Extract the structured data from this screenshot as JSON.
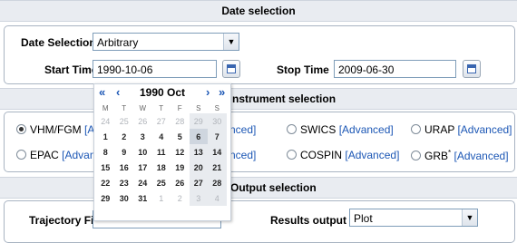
{
  "date_section": {
    "title": "Date selection",
    "date_selection_label": "Date Selection",
    "date_selection_value": "Arbitrary",
    "start_time_label": "Start Time",
    "start_time_value": "1990-10-06",
    "stop_time_label": "Stop Time",
    "stop_time_value": "2009-06-30"
  },
  "instrument_section": {
    "title_visible": "nstrument selection",
    "items": [
      {
        "name": "VHM/FGM",
        "adv": "[Adv",
        "checked": true
      },
      {
        "name": "",
        "adv": "nced]",
        "checked": false
      },
      {
        "name": "SWICS",
        "adv": "[Advanced]",
        "checked": false
      },
      {
        "name": "URAP",
        "adv": "[Advanced]",
        "checked": false
      },
      {
        "name": "EPAC",
        "adv": "[Advance",
        "checked": false
      },
      {
        "name": "",
        "adv": "nced]",
        "checked": false
      },
      {
        "name": "COSPIN",
        "adv": "[Advanced]",
        "checked": false
      },
      {
        "name": "GRB",
        "sup": "*",
        "adv": "[Advanced]",
        "checked": false
      }
    ]
  },
  "output_section": {
    "title_visible": "Output selection",
    "trajectory_label": "Trajectory File",
    "results_label": "Results output",
    "results_value": "Plot"
  },
  "calendar": {
    "nav_prev_year": "«",
    "nav_prev_month": "‹",
    "nav_next_month": "›",
    "nav_next_year": "»",
    "title": "1990 Oct",
    "weekdays": [
      "M",
      "T",
      "W",
      "T",
      "F",
      "S",
      "S"
    ],
    "weeks": [
      [
        "24",
        "25",
        "26",
        "27",
        "28",
        "29",
        "30"
      ],
      [
        "1",
        "2",
        "3",
        "4",
        "5",
        "6",
        "7"
      ],
      [
        "8",
        "9",
        "10",
        "11",
        "12",
        "13",
        "14"
      ],
      [
        "15",
        "16",
        "17",
        "18",
        "19",
        "20",
        "21"
      ],
      [
        "22",
        "23",
        "24",
        "25",
        "26",
        "27",
        "28"
      ],
      [
        "29",
        "30",
        "31",
        "1",
        "2",
        "3",
        "4"
      ]
    ],
    "selected": "6"
  }
}
